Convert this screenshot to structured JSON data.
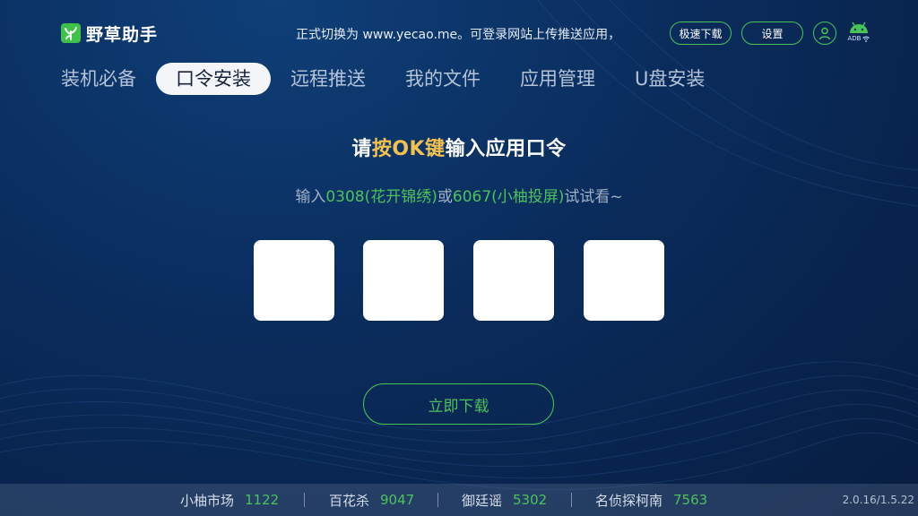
{
  "app": {
    "name": "野草助手"
  },
  "header": {
    "marquee": "正式切换为 www.yecao.me。可登录网站上传推送应用，",
    "fast_download_label": "极速下载",
    "settings_label": "设置",
    "adb_label": "ADB"
  },
  "tabs": [
    {
      "label": "装机必备",
      "active": false
    },
    {
      "label": "口令安装",
      "active": true
    },
    {
      "label": "远程推送",
      "active": false
    },
    {
      "label": "我的文件",
      "active": false
    },
    {
      "label": "应用管理",
      "active": false
    },
    {
      "label": "U盘安装",
      "active": false
    }
  ],
  "main": {
    "heading_pre": "请",
    "heading_accent": "按OK键",
    "heading_post": "输入应用口令",
    "hint_pre": "输入",
    "hint_code1": "0308(花开锦绣)",
    "hint_mid": "或",
    "hint_code2": "6067(小柚投屏)",
    "hint_post": "试试看~",
    "code_values": [
      "",
      "",
      "",
      ""
    ],
    "download_label": "立即下载"
  },
  "footer": {
    "stats": [
      {
        "label": "小柚市场",
        "value": "1122"
      },
      {
        "label": "百花杀",
        "value": "9047"
      },
      {
        "label": "御廷谣",
        "value": "5302"
      },
      {
        "label": "名侦探柯南",
        "value": "7563"
      }
    ],
    "version": "2.0.16/1.5.22"
  },
  "colors": {
    "accent_green": "#46c455",
    "accent_yellow": "#f2c14f",
    "background": "#0a2c5c"
  }
}
